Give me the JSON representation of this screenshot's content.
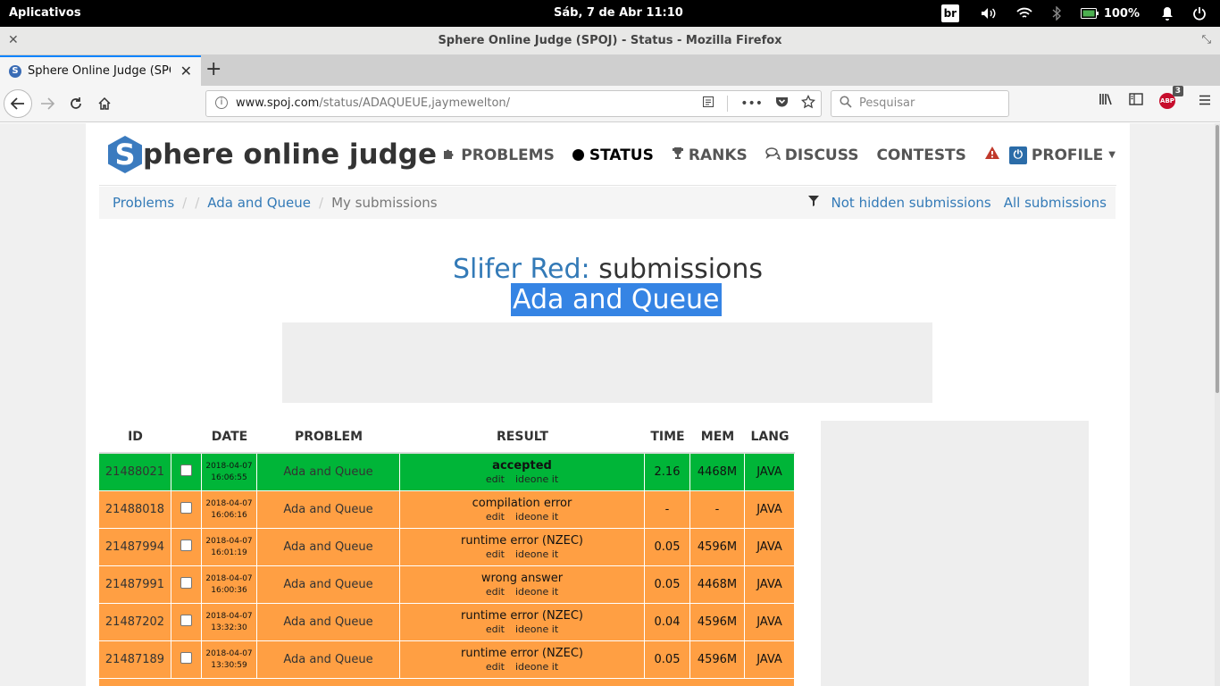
{
  "system": {
    "apps_label": "Aplicativos",
    "clock": "Sáb,  7 de Abr    11:10",
    "keyboard_layout": "br",
    "battery": "100%"
  },
  "window": {
    "title": "Sphere Online Judge (SPOJ) - Status - Mozilla Firefox"
  },
  "browser": {
    "tab_title": "Sphere Online Judge (SPOJ) - S",
    "favicon_letter": "S",
    "url_host": "www.spoj.com",
    "url_path": "/status/ADAQUEUE,jaymewelton/",
    "search_placeholder": "Pesquisar",
    "adblock_label": "ABP",
    "adblock_count": "3"
  },
  "site": {
    "logo_letter": "S",
    "logo_rest": "phere online judge",
    "nav": {
      "problems": "PROBLEMS",
      "status": "STATUS",
      "ranks": "RANKS",
      "discuss": "DISCUSS",
      "contests": "CONTESTS",
      "profile": "PROFILE"
    },
    "breadcrumb": {
      "problems": "Problems",
      "sep": "/",
      "problem": "Ada and Queue",
      "current": "My submissions",
      "not_hidden": "Not hidden submissions",
      "all": "All submissions"
    },
    "title_user": "Slifer Red:",
    "title_suffix": " submissions",
    "title_problem": "Ada and Queue"
  },
  "table": {
    "headers": {
      "id": "ID",
      "date": "DATE",
      "problem": "PROBLEM",
      "result": "RESULT",
      "time": "TIME",
      "mem": "MEM",
      "lang": "LANG"
    },
    "link_edit": "edit",
    "link_ideone": "ideone it",
    "rows": [
      {
        "id": "21488021",
        "date": "2018-04-07",
        "clock": "16:06:55",
        "problem": "Ada and Queue",
        "result": "accepted",
        "time": "2.16",
        "mem": "4468M",
        "lang": "JAVA",
        "status": "accepted"
      },
      {
        "id": "21488018",
        "date": "2018-04-07",
        "clock": "16:06:16",
        "problem": "Ada and Queue",
        "result": "compilation error",
        "time": "-",
        "mem": "-",
        "lang": "JAVA",
        "status": "failed"
      },
      {
        "id": "21487994",
        "date": "2018-04-07",
        "clock": "16:01:19",
        "problem": "Ada and Queue",
        "result": "runtime error (NZEC)",
        "time": "0.05",
        "mem": "4596M",
        "lang": "JAVA",
        "status": "failed"
      },
      {
        "id": "21487991",
        "date": "2018-04-07",
        "clock": "16:00:36",
        "problem": "Ada and Queue",
        "result": "wrong answer",
        "time": "0.05",
        "mem": "4468M",
        "lang": "JAVA",
        "status": "failed"
      },
      {
        "id": "21487202",
        "date": "2018-04-07",
        "clock": "13:32:30",
        "problem": "Ada and Queue",
        "result": "runtime error (NZEC)",
        "time": "0.04",
        "mem": "4596M",
        "lang": "JAVA",
        "status": "failed"
      },
      {
        "id": "21487189",
        "date": "2018-04-07",
        "clock": "13:30:59",
        "problem": "Ada and Queue",
        "result": "runtime error (NZEC)",
        "time": "0.05",
        "mem": "4596M",
        "lang": "JAVA",
        "status": "failed"
      }
    ]
  },
  "colors": {
    "accepted": "#00b538",
    "failed": "#ff9f43",
    "link": "#337ab7",
    "selection": "#3584e4"
  }
}
